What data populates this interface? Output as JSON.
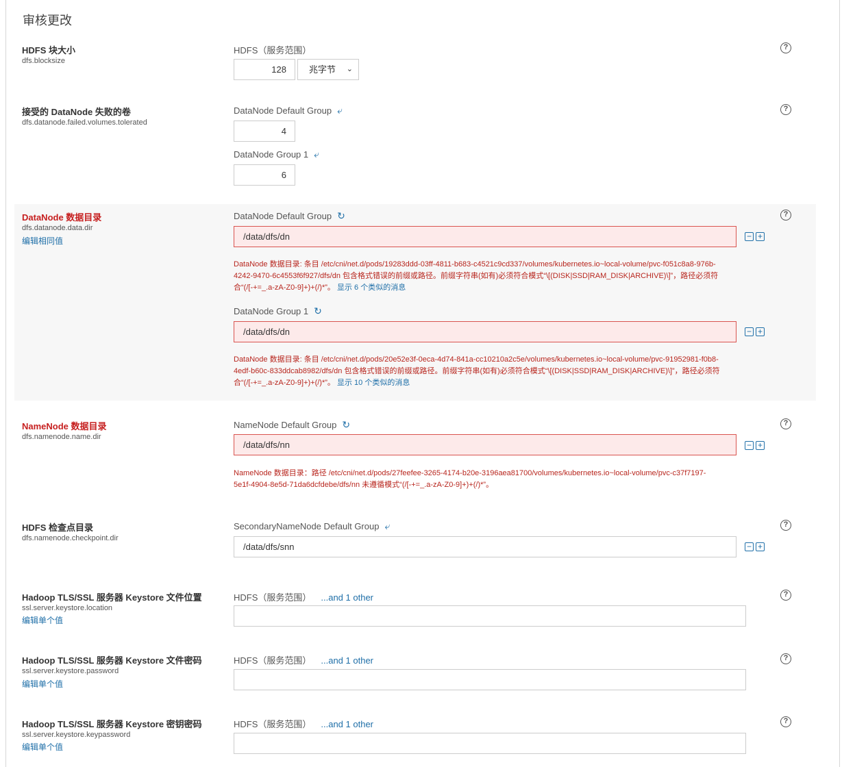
{
  "page_title": "审核更改",
  "colors": {
    "error": "#c61f1f",
    "link": "#1f6fa8",
    "error_bg": "#fdeaea"
  },
  "blocksize": {
    "label": "HDFS 块大小",
    "key": "dfs.blocksize",
    "group": "HDFS（服务范围）",
    "value": "128",
    "unit": "兆字节"
  },
  "failed_volumes": {
    "label": "接受的 DataNode 失败的卷",
    "key": "dfs.datanode.failed.volumes.tolerated",
    "groups": [
      {
        "name": "DataNode Default Group",
        "value": "4"
      },
      {
        "name": "DataNode Group 1",
        "value": "6"
      }
    ]
  },
  "data_dir": {
    "label": "DataNode 数据目录",
    "key": "dfs.datanode.data.dir",
    "link": "编辑相同值",
    "groups": [
      {
        "name": "DataNode Default Group",
        "value": "/data/dfs/dn",
        "error_lines": [
          "DataNode 数据目录: 条目 /etc/cni/net.d/pods/19283ddd-03ff-4811-b683-c4521c9cd337/volumes/kubernetes.io~local-volume/pvc-f051c8a8-976b-",
          "4242-9470-6c4553f6f927/dfs/dn 包含格式错误的前缀或路径。前缀字符串(如有)必须符合模式“\\[(DISK|SSD|RAM_DISK|ARCHIVE)\\]”，路径必须符",
          "合“(/[-+=_.a-zA-Z0-9]+)+(/)*”。"
        ],
        "more": "显示 6 个类似的消息"
      },
      {
        "name": "DataNode Group 1",
        "value": "/data/dfs/dn",
        "error_lines": [
          "DataNode 数据目录: 条目 /etc/cni/net.d/pods/20e52e3f-0eca-4d74-841a-cc10210a2c5e/volumes/kubernetes.io~local-volume/pvc-91952981-f0b8-",
          "4edf-b60c-833ddcab8982/dfs/dn 包含格式错误的前缀或路径。前缀字符串(如有)必须符合模式“\\[(DISK|SSD|RAM_DISK|ARCHIVE)\\]”，路径必须符",
          "合“(/[-+=_.a-zA-Z0-9]+)+(/)*”。"
        ],
        "more": "显示 10 个类似的消息"
      }
    ]
  },
  "name_dir": {
    "label": "NameNode 数据目录",
    "key": "dfs.namenode.name.dir",
    "group": "NameNode Default Group",
    "value": "/data/dfs/nn",
    "error_lines": [
      "NameNode 数据目录：路径 /etc/cni/net.d/pods/27feefee-3265-4174-b20e-3196aea81700/volumes/kubernetes.io~local-volume/pvc-c37f7197-",
      "5e1f-4904-8e5d-71da6dcfdebe/dfs/nn 未遵循模式“(/[-+=_.a-zA-Z0-9]+)+(/)*”。"
    ]
  },
  "checkpoint": {
    "label": "HDFS 检查点目录",
    "key": "dfs.namenode.checkpoint.dir",
    "group": "SecondaryNameNode Default Group",
    "value": "/data/dfs/snn"
  },
  "keystore_location": {
    "label": "Hadoop TLS/SSL 服务器 Keystore 文件位置",
    "key": "ssl.server.keystore.location",
    "link": "编辑单个值",
    "group": "HDFS（服务范围）",
    "other": "...and 1 other",
    "value": ""
  },
  "keystore_password": {
    "label": "Hadoop TLS/SSL 服务器 Keystore 文件密码",
    "key": "ssl.server.keystore.password",
    "link": "编辑单个值",
    "group": "HDFS（服务范围）",
    "other": "...and 1 other",
    "value": ""
  },
  "keystore_keypassword": {
    "label": "Hadoop TLS/SSL 服务器 Keystore 密钥密码",
    "key": "ssl.server.keystore.keypassword",
    "link": "编辑单个值",
    "group": "HDFS（服务范围）",
    "other": "...and 1 other",
    "value": ""
  },
  "icons": {
    "help": "help-circle-icon",
    "undo": "undo-arrow-icon",
    "revert": "revert-icon",
    "minus": "minus-square-icon",
    "plus": "plus-square-icon"
  }
}
